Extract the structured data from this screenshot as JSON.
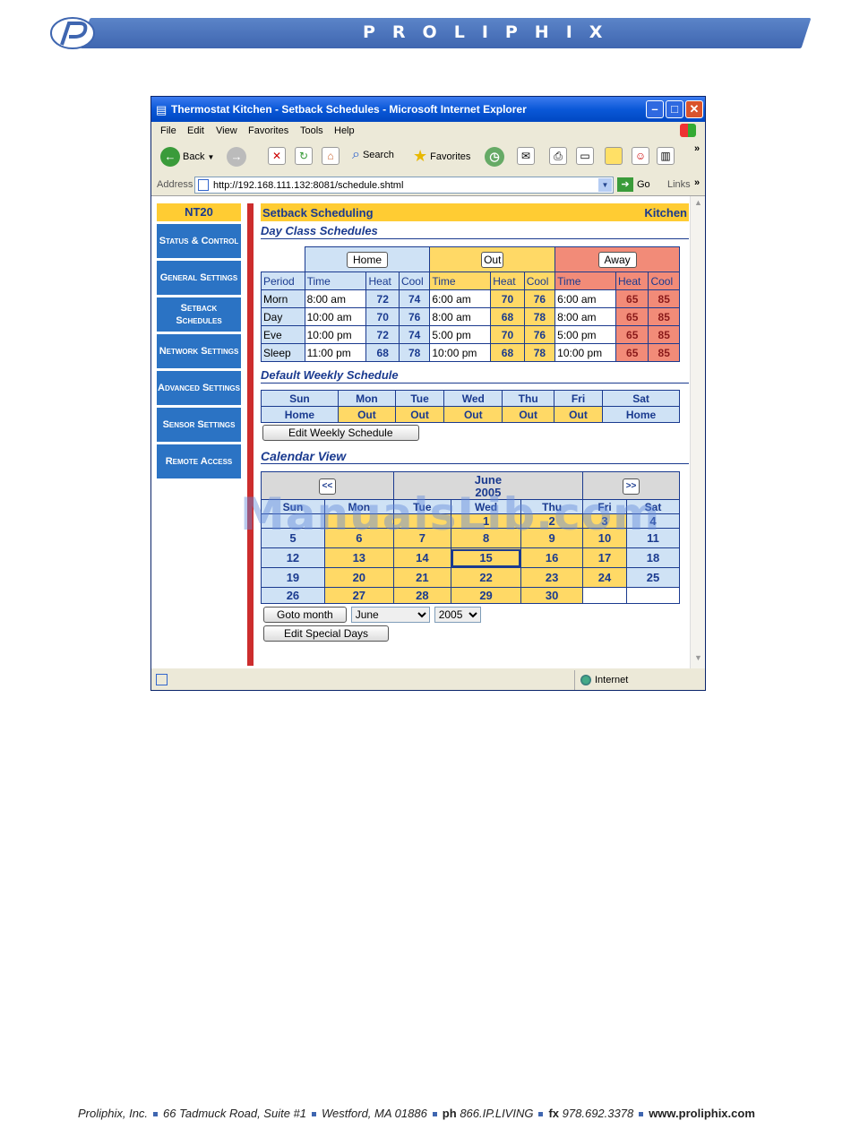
{
  "banner": {
    "title": "PROLIPHIX"
  },
  "window": {
    "title": "Thermostat Kitchen - Setback Schedules - Microsoft Internet Explorer",
    "menu": [
      "File",
      "Edit",
      "View",
      "Favorites",
      "Tools",
      "Help"
    ],
    "toolbar": {
      "back": "Back",
      "search": "Search",
      "favorites": "Favorites",
      "chevron": "»"
    },
    "address_label": "Address",
    "url": "http://192.168.111.132:8081/schedule.shtml",
    "go": "Go",
    "links": "Links",
    "status_zone": "Internet"
  },
  "nav": {
    "device": "NT20",
    "items": [
      "Status & Control",
      "General Settings",
      "Setback Schedules",
      "Network Settings",
      "Advanced Settings",
      "Sensor Settings",
      "Remote Access"
    ]
  },
  "page": {
    "heading": "Setback Scheduling",
    "location": "Kitchen",
    "day_class_title": "Day Class Schedules",
    "classes": [
      "Home",
      "Out",
      "Away"
    ],
    "col_period": "Period",
    "col_time": "Time",
    "col_heat": "Heat",
    "col_cool": "Cool",
    "periods": [
      {
        "name": "Morn",
        "home": [
          "8:00 am",
          "72",
          "74"
        ],
        "out": [
          "6:00 am",
          "70",
          "76"
        ],
        "away": [
          "6:00 am",
          "65",
          "85"
        ]
      },
      {
        "name": "Day",
        "home": [
          "10:00 am",
          "70",
          "76"
        ],
        "out": [
          "8:00 am",
          "68",
          "78"
        ],
        "away": [
          "8:00 am",
          "65",
          "85"
        ]
      },
      {
        "name": "Eve",
        "home": [
          "10:00 pm",
          "72",
          "74"
        ],
        "out": [
          "5:00 pm",
          "70",
          "76"
        ],
        "away": [
          "5:00 pm",
          "65",
          "85"
        ]
      },
      {
        "name": "Sleep",
        "home": [
          "11:00 pm",
          "68",
          "78"
        ],
        "out": [
          "10:00 pm",
          "68",
          "78"
        ],
        "away": [
          "10:00 pm",
          "65",
          "85"
        ]
      }
    ],
    "weekly_title": "Default Weekly Schedule",
    "days": [
      "Sun",
      "Mon",
      "Tue",
      "Wed",
      "Thu",
      "Fri",
      "Sat"
    ],
    "weekly": [
      "Home",
      "Out",
      "Out",
      "Out",
      "Out",
      "Out",
      "Home"
    ],
    "edit_weekly": "Edit Weekly Schedule",
    "calendar_title": "Calendar View",
    "cal_prev": "<<",
    "cal_next": ">>",
    "cal_month": "June",
    "cal_year": "2005",
    "cal_weeks": [
      [
        "",
        "",
        "",
        "1",
        "2",
        "3",
        "4"
      ],
      [
        "5",
        "6",
        "7",
        "8",
        "9",
        "10",
        "11"
      ],
      [
        "12",
        "13",
        "14",
        "15",
        "16",
        "17",
        "18"
      ],
      [
        "19",
        "20",
        "21",
        "22",
        "23",
        "24",
        "25"
      ],
      [
        "26",
        "27",
        "28",
        "29",
        "30",
        "",
        ""
      ]
    ],
    "goto_month": "Goto month",
    "month_select": "June",
    "year_select": "2005",
    "edit_special": "Edit Special Days"
  },
  "watermark": "ManualsLib.com",
  "footer": {
    "company": "Proliphix, Inc.",
    "address": "66 Tadmuck Road, Suite #1",
    "city": "Westford, MA 01886",
    "ph_label": "ph",
    "phone": "866.IP.LIVING",
    "fx_label": "fx",
    "fax": "978.692.3378",
    "web": "www.proliphix.com"
  }
}
